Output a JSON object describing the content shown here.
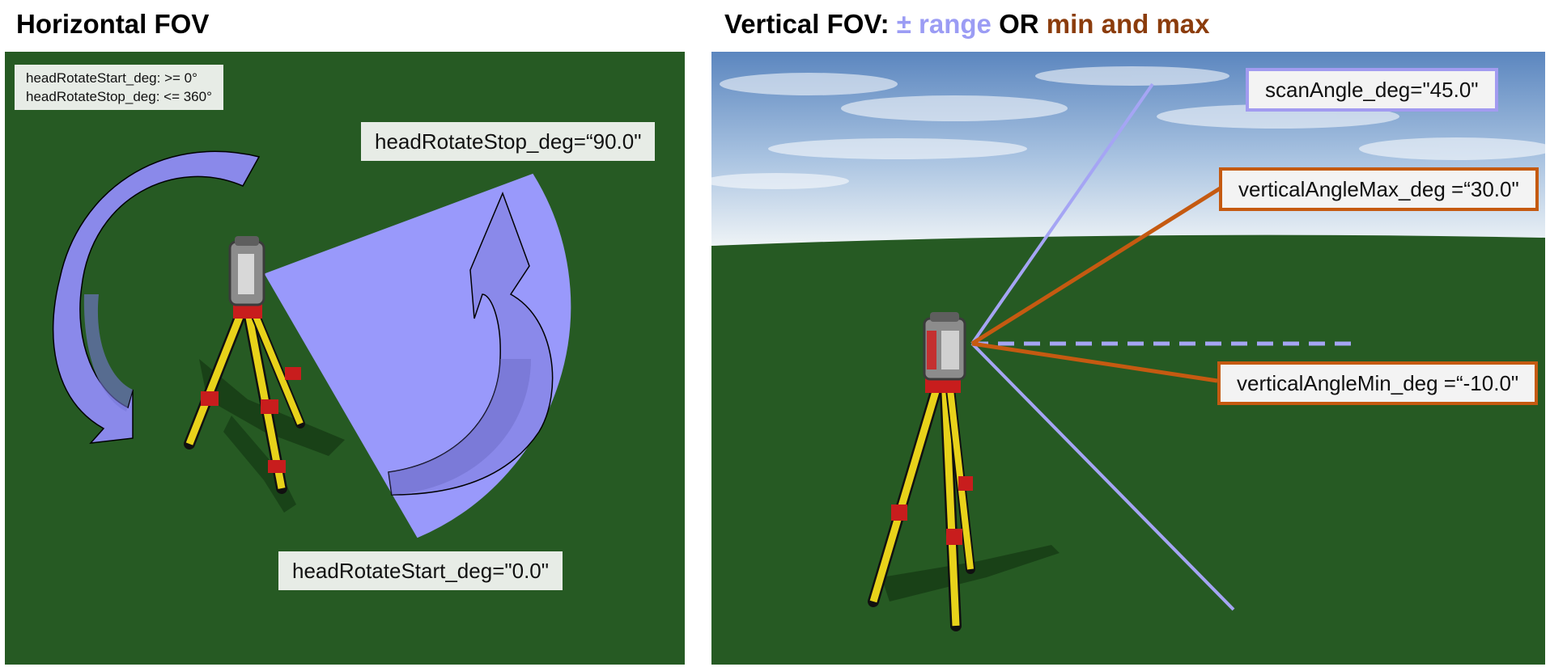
{
  "left": {
    "heading": "Horizontal FOV",
    "range_note": {
      "line1": "headRotateStart_deg: >= 0°",
      "line2": "headRotateStop_deg: <= 360°"
    },
    "stop_label": "headRotateStop_deg=“90.0\"",
    "start_label": "headRotateStart_deg=\"0.0\""
  },
  "right": {
    "heading_prefix": "Vertical FOV: ",
    "heading_range": "± range",
    "heading_or": " OR ",
    "heading_minmax": "min and max",
    "scan_label": "scanAngle_deg=\"45.0\"",
    "vmax_label": "verticalAngleMax_deg =“30.0\"",
    "vmin_label": "verticalAngleMin_deg =“-10.0\""
  },
  "colors": {
    "ground": "#265a23",
    "range_accent": "#9b9cf4",
    "minmax_accent": "#c55a11",
    "minmax_text": "#8b3c0c",
    "label_bg": "#e7ece6"
  }
}
